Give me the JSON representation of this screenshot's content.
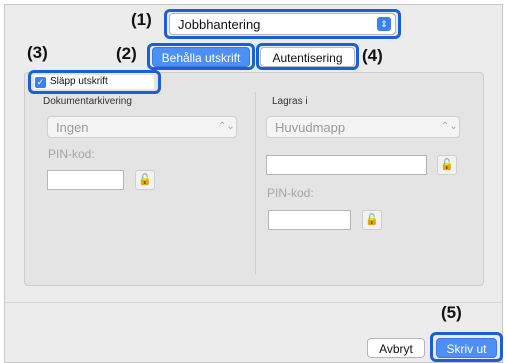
{
  "callouts": {
    "c1": "(1)",
    "c2": "(2)",
    "c3": "(3)",
    "c4": "(4)",
    "c5": "(5)"
  },
  "top_popup": {
    "value": "Jobbhantering",
    "arrow_icon": "up-down-chevron-icon"
  },
  "tabs": [
    {
      "label": "Behålla utskrift",
      "selected": true
    },
    {
      "label": "Autentisering",
      "selected": false
    }
  ],
  "release_print": {
    "label": "Släpp utskrift",
    "checked": true
  },
  "left_section": {
    "title": "Dokumentarkivering",
    "popup_value": "Ingen",
    "pin_label": "PIN-kod:",
    "lock_icon": "lock-icon"
  },
  "right_section": {
    "title": "Lagras i",
    "popup_value": "Huvudmapp",
    "pin_label": "PIN-kod:",
    "lock_icon": "lock-icon"
  },
  "footer": {
    "cancel_label": "Avbryt",
    "print_label": "Skriv ut"
  },
  "colors": {
    "highlight": "#1c5ed6",
    "accent": "#4c8ff7"
  }
}
